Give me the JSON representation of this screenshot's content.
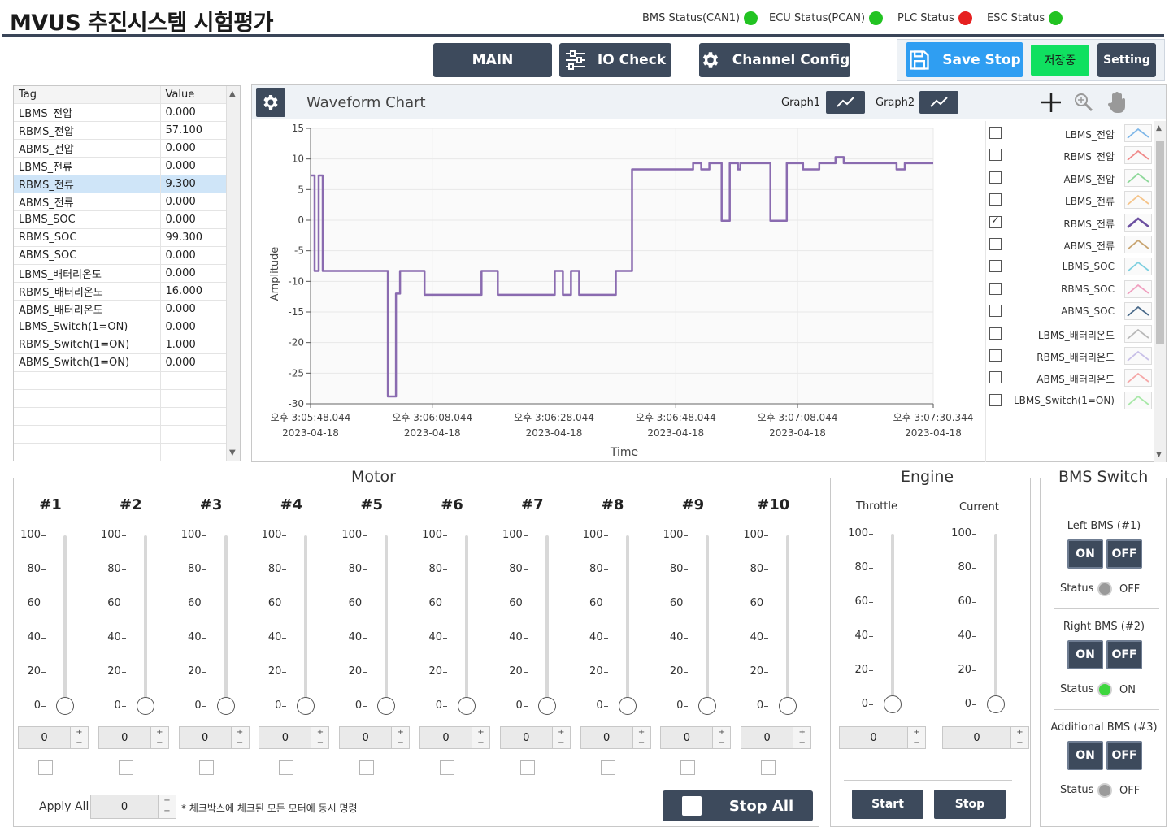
{
  "app": {
    "title": "MVUS 추진시스템 시험평가"
  },
  "statuses": [
    {
      "label": "BMS Status(CAN1)",
      "color": "#22c322"
    },
    {
      "label": "ECU Status(PCAN)",
      "color": "#22c322"
    },
    {
      "label": "PLC Status",
      "color": "#e62020"
    },
    {
      "label": "ESC Status",
      "color": "#22c322"
    }
  ],
  "nav": {
    "main": "MAIN",
    "io_check": "IO Check",
    "channel_config": "Channel Config",
    "save_stop": "Save Stop",
    "saving": "저장중",
    "setting": "Setting"
  },
  "tag_table": {
    "headers": [
      "Tag",
      "Value"
    ],
    "selected_index": 4,
    "rows": [
      [
        "LBMS_전압",
        "0.000"
      ],
      [
        "RBMS_전압",
        "57.100"
      ],
      [
        "ABMS_전압",
        "0.000"
      ],
      [
        "LBMS_전류",
        "0.000"
      ],
      [
        "RBMS_전류",
        "9.300"
      ],
      [
        "ABMS_전류",
        "0.000"
      ],
      [
        "LBMS_SOC",
        "0.000"
      ],
      [
        "RBMS_SOC",
        "99.300"
      ],
      [
        "ABMS_SOC",
        "0.000"
      ],
      [
        "LBMS_배터리온도",
        "0.000"
      ],
      [
        "RBMS_배터리온도",
        "16.000"
      ],
      [
        "ABMS_배터리온도",
        "0.000"
      ],
      [
        "LBMS_Switch(1=ON)",
        "0.000"
      ],
      [
        "RBMS_Switch(1=ON)",
        "1.000"
      ],
      [
        "ABMS_Switch(1=ON)",
        "0.000"
      ]
    ]
  },
  "chart": {
    "title": "Waveform Chart",
    "graph1": "Graph1",
    "graph2": "Graph2"
  },
  "chart_data": {
    "type": "line",
    "ylabel": "Amplitude",
    "xlabel": "Time",
    "ylim": [
      -30,
      15
    ],
    "yticks": [
      "15",
      "10",
      "5",
      "0",
      "-5",
      "-10",
      "-15",
      "-20",
      "-25",
      "-30"
    ],
    "xtick_times": [
      "오후 3:05:48.044",
      "오후 3:06:08.044",
      "오후 3:06:28.044",
      "오후 3:06:48.044",
      "오후 3:07:08.044",
      "오후 3:07:30.344"
    ],
    "xtick_dates": [
      "2023-04-18",
      "2023-04-18",
      "2023-04-18",
      "2023-04-18",
      "2023-04-18",
      "2023-04-18"
    ],
    "series": [
      {
        "name": "RBMS_전류",
        "color": "#8a6bb0",
        "x": [
          0,
          0.5,
          0.5,
          1.0,
          1.0,
          1.5,
          1.5,
          2.0,
          2.0,
          9.5,
          9.5,
          10.5,
          10.5,
          11.0,
          11.0,
          14.0,
          14.0,
          21.0,
          21.0,
          23.0,
          23.0,
          30.0,
          30.0,
          31.0,
          31.0,
          32.0,
          32.0,
          33.0,
          33.0,
          37.5,
          37.5,
          39.5,
          39.5,
          47.0,
          47.0,
          48.0,
          48.0,
          49.0,
          49.0,
          50.5,
          50.5,
          51.5,
          51.5,
          52.5,
          52.5,
          52.8,
          52.8,
          53.5,
          53.5,
          56.5,
          56.5,
          58.5,
          58.5,
          60.5,
          60.5,
          62.5,
          62.5,
          64.5,
          64.5,
          65.5,
          65.5,
          72.0,
          72.0,
          73.0,
          73.0,
          76.5
        ],
        "y": [
          7.3,
          7.3,
          -8.3,
          -8.3,
          7.3,
          7.3,
          -8.3,
          -8.3,
          -8.3,
          -8.3,
          -28.8,
          -28.8,
          -12.0,
          -12.0,
          -8.3,
          -8.3,
          -12.2,
          -12.2,
          -8.3,
          -8.3,
          -12.2,
          -12.2,
          -8.3,
          -8.3,
          -12.2,
          -12.2,
          -8.3,
          -8.3,
          -12.2,
          -12.2,
          -8.3,
          -8.3,
          8.3,
          8.3,
          9.3,
          9.3,
          8.3,
          8.3,
          9.3,
          9.3,
          -0.1,
          -0.1,
          9.3,
          9.3,
          8.3,
          8.3,
          9.3,
          9.3,
          9.3,
          9.3,
          -0.1,
          -0.1,
          9.3,
          9.3,
          8.3,
          8.3,
          9.3,
          9.3,
          10.3,
          10.3,
          9.3,
          9.3,
          8.3,
          8.3,
          9.3,
          9.3
        ]
      }
    ]
  },
  "legend": [
    {
      "label": "LBMS_전압",
      "checked": false,
      "color": "#7fb7e8"
    },
    {
      "label": "RBMS_전압",
      "checked": false,
      "color": "#f08a8a"
    },
    {
      "label": "ABMS_전압",
      "checked": false,
      "color": "#8ed89a"
    },
    {
      "label": "LBMS_전류",
      "checked": false,
      "color": "#f5c48a"
    },
    {
      "label": "RBMS_전류",
      "checked": true,
      "color": "#6b4fa0"
    },
    {
      "label": "ABMS_전류",
      "checked": false,
      "color": "#c8a470"
    },
    {
      "label": "LBMS_SOC",
      "checked": false,
      "color": "#7fd0e0"
    },
    {
      "label": "RBMS_SOC",
      "checked": false,
      "color": "#f0a0c0"
    },
    {
      "label": "ABMS_SOC",
      "checked": false,
      "color": "#4a6a8a"
    },
    {
      "label": "LBMS_배터리온도",
      "checked": false,
      "color": "#b8b8b8"
    },
    {
      "label": "RBMS_배터리온도",
      "checked": false,
      "color": "#c8c0e8"
    },
    {
      "label": "ABMS_배터리온도",
      "checked": false,
      "color": "#f5a8a8"
    },
    {
      "label": "LBMS_Switch(1=ON)",
      "checked": false,
      "color": "#a8e8a8"
    }
  ],
  "motor": {
    "title": "Motor",
    "scale": [
      "100",
      "80",
      "60",
      "40",
      "20",
      "0"
    ],
    "channels": [
      {
        "label": "#1",
        "value": "0",
        "level": 0
      },
      {
        "label": "#2",
        "value": "0",
        "level": 0
      },
      {
        "label": "#3",
        "value": "0",
        "level": 0
      },
      {
        "label": "#4",
        "value": "0",
        "level": 0
      },
      {
        "label": "#5",
        "value": "0",
        "level": 0
      },
      {
        "label": "#6",
        "value": "0",
        "level": 0
      },
      {
        "label": "#7",
        "value": "0",
        "level": 0
      },
      {
        "label": "#8",
        "value": "0",
        "level": 0
      },
      {
        "label": "#9",
        "value": "0",
        "level": 0
      },
      {
        "label": "#10",
        "value": "0",
        "level": 0
      }
    ],
    "apply_all_label": "Apply All",
    "apply_all_value": "0",
    "apply_note": "* 체크박스에 체크된 모든 모터에 동시 명령",
    "stop_all": "Stop All"
  },
  "engine": {
    "title": "Engine",
    "throttle": {
      "label": "Throttle",
      "value": "0",
      "level": 0
    },
    "current": {
      "label": "Current",
      "value": "0",
      "level": 0
    },
    "start": "Start",
    "stop": "Stop"
  },
  "bms_switch": {
    "title": "BMS Switch",
    "on": "ON",
    "off": "OFF",
    "status_label": "Status",
    "items": [
      {
        "label": "Left BMS (#1)",
        "status": "OFF",
        "color": "#9a9a9a"
      },
      {
        "label": "Right BMS (#2)",
        "status": "ON",
        "color": "#3dd63d"
      },
      {
        "label": "Additional BMS (#3)",
        "status": "OFF",
        "color": "#9a9a9a"
      }
    ]
  }
}
